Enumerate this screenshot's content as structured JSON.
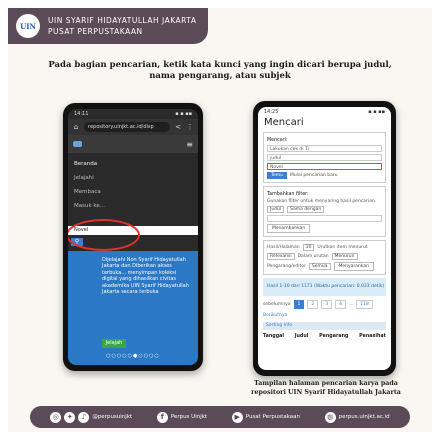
{
  "header": {
    "logo_text": "UIN",
    "line1": "UIN SYARIF HIDAYATULLAH JAKARTA",
    "line2": "PUSAT PERPUSTAKAAN"
  },
  "heading": {
    "line1": "Pada bagian pencarian, ketik kata kunci yang ingin dicari berupa judul,",
    "line2": "nama pengarang, atau subjek"
  },
  "phone1": {
    "time": "14:11",
    "status_icons": "▪ ▪ ▪▪",
    "url": "repository.uinjkt.ac.id/disp",
    "menu": [
      "Beranda",
      "Jelajahi",
      "Membaca",
      "Masuk ke..."
    ],
    "search_value": "Novel",
    "search_icon": "search-icon",
    "promo_text": "Dijelajahi Non Syarif Hidayatullah Jakarta dan Diberikan akses terbuka... menyimpan koleksi digital yang dihasilkan civitas akademika UIN Syarif Hidayatullah Jakarta secara terbuka",
    "promo_button": "Jelajah",
    "dots": "○○○○○●○○○○"
  },
  "phone2": {
    "time": "14:25",
    "title": "Mencari",
    "search_label": "Mencari:",
    "scope_options": [
      "Lakukan cek di Ti",
      "judul"
    ],
    "query_value": "Novel",
    "search_button": "Temu",
    "search_reset": "Mulai pencarian baru",
    "filter_title": "Tambahkan filter:",
    "filter_hint": "Gunakan filter untuk menyaring hasil pencarian.",
    "filter_field": "Judul",
    "filter_op": "Sama dengan",
    "filter_apply": "Menambahkan",
    "rpp_label": "Hasil/Halaman",
    "rpp_value": "10",
    "sort_label": "Urutkan item menurut",
    "sort_value": "Relevansi",
    "order_label": "Dalam urutan",
    "order_value": "Menurun",
    "author_label": "Pengarang/editor",
    "author_value": "Semua",
    "author_button": "Menyarankan",
    "result_info": "Hasil 1-10 dari 1171 (Waktu pencarian: 0.033 detik)",
    "prev": "sebelumnya",
    "pages": [
      "1",
      "2",
      "3",
      "4",
      "...",
      "118"
    ],
    "next": "Berikutnya",
    "sort_bar": "Sorting Info",
    "col_issued": "Tanggal",
    "col_title": "Judul",
    "col_author": "Pengarang",
    "col_advisor": "Penasihat"
  },
  "caption": {
    "line1": "Tampilan halaman pencarian karya pada",
    "line2": "repositori UIN Syarif Hidayatullah Jakarta"
  },
  "footer": {
    "social_handle": "@perpusuinjkt",
    "facebook": "Perpus Uinjkt",
    "youtube": "Pusat Perpustakaan",
    "website": "perpus.uinjkt.ac.id"
  }
}
